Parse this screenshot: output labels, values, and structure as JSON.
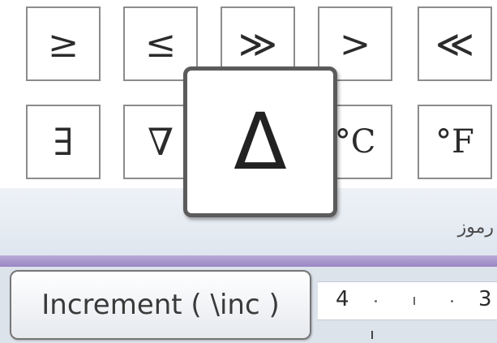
{
  "symbol_gallery": {
    "row1": [
      "≥",
      "≤",
      "≫",
      ">",
      "≪"
    ],
    "row2": [
      "∃",
      "∇",
      "",
      "°C",
      "°F"
    ]
  },
  "preview": {
    "glyph": "Δ"
  },
  "group": {
    "label": "رموز"
  },
  "command_tooltip": {
    "text": "Increment ( \\inc )"
  },
  "ruler": {
    "numbers": [
      "4",
      "3"
    ]
  },
  "colors": {
    "ribbon_edge": "#a594cc",
    "border": "#8c8c8c"
  }
}
